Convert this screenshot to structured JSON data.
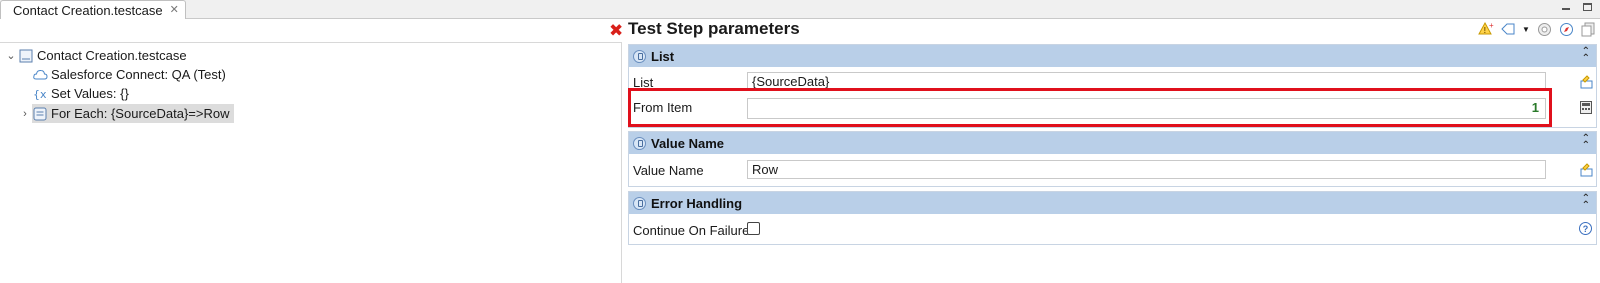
{
  "tab": {
    "title": "Contact Creation.testcase",
    "close": "✕"
  },
  "tree": {
    "root": "Contact Creation.testcase",
    "items": [
      {
        "label": "Salesforce Connect: QA (Test)"
      },
      {
        "label": "Set Values: {}"
      },
      {
        "label": "For Each: {SourceData}=>Row"
      }
    ]
  },
  "panel": {
    "title": "Test Step parameters",
    "sections": [
      {
        "header": "List",
        "fields": [
          {
            "label": "List",
            "value": "{SourceData}"
          },
          {
            "label": "From Item",
            "value": "1"
          }
        ]
      },
      {
        "header": "Value Name",
        "fields": [
          {
            "label": "Value Name",
            "value": "Row"
          }
        ]
      },
      {
        "header": "Error Handling",
        "fields": [
          {
            "label": "Continue On Failure"
          }
        ]
      }
    ]
  },
  "colors": {
    "error": "#d9201a",
    "section_header": "#b9cfe8",
    "highlight": "#e0101c"
  }
}
